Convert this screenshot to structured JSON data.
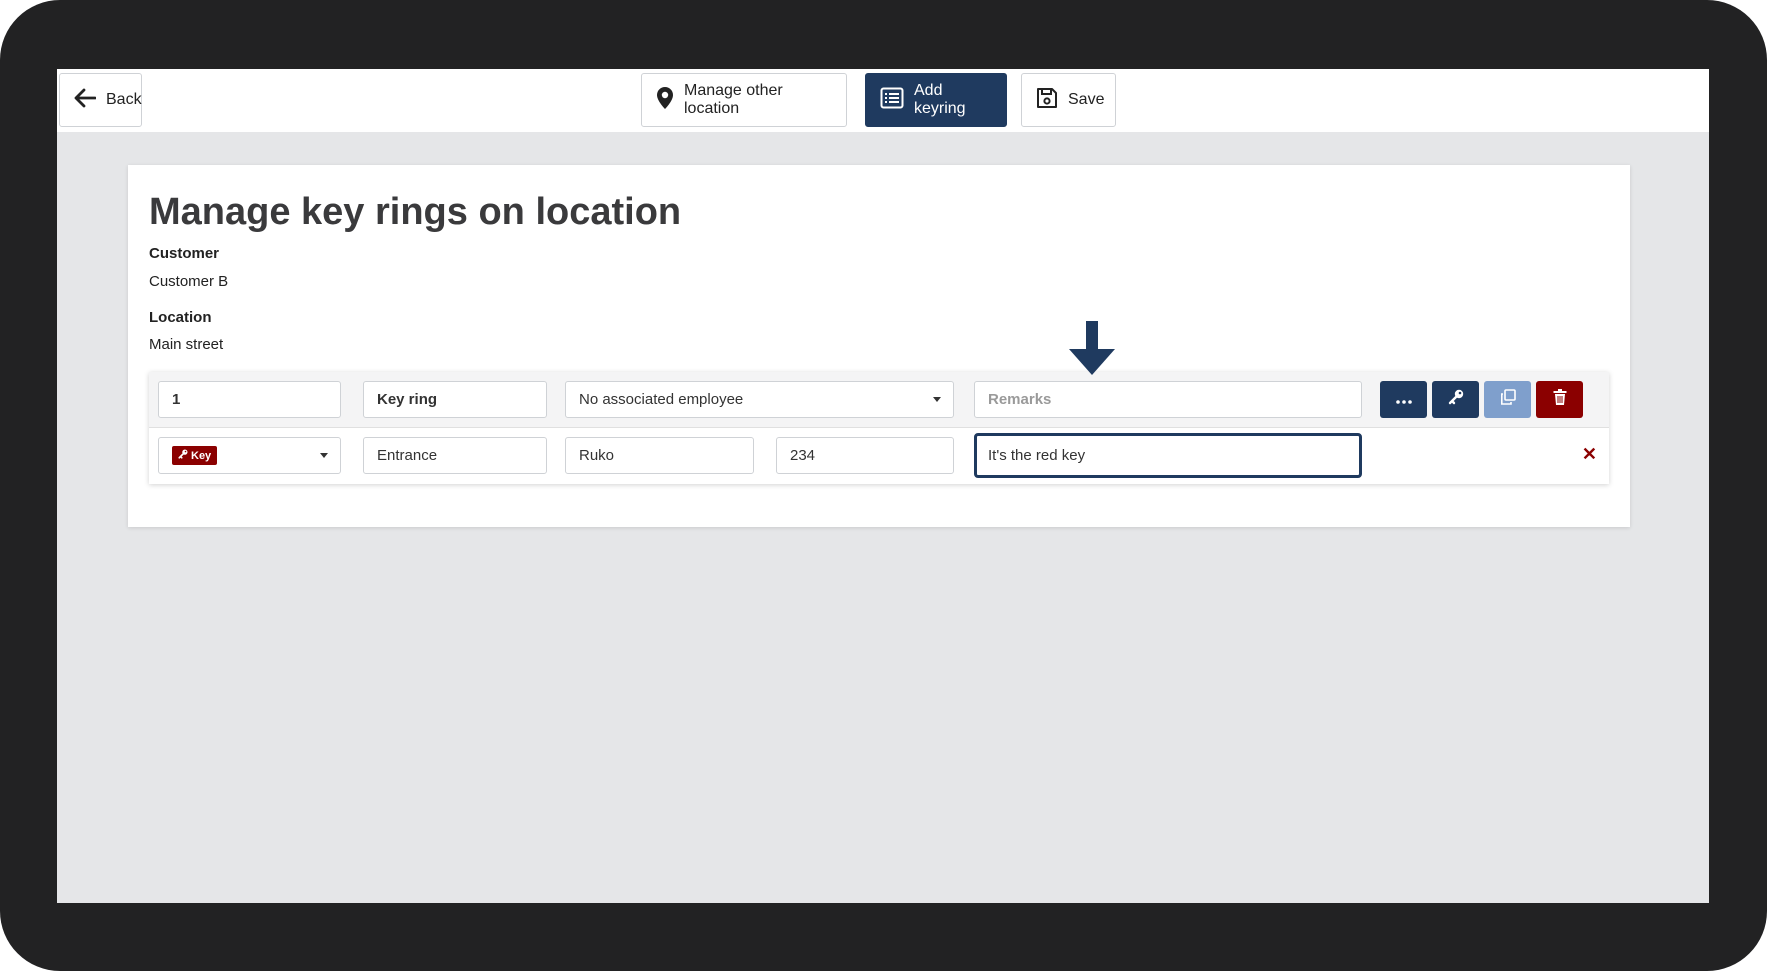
{
  "toolbar": {
    "back_label": "Back",
    "manage_other_location_label": "Manage other location",
    "add_keyring_label": "Add keyring",
    "save_label": "Save"
  },
  "page": {
    "title": "Manage key rings on location",
    "customer_label": "Customer",
    "customer_value": "Customer B",
    "location_label": "Location",
    "location_value": "Main street"
  },
  "keyring_row": {
    "number": "1",
    "name": "Key ring",
    "employee_select": "No associated employee",
    "remarks_placeholder": "Remarks"
  },
  "key_row": {
    "type_badge": "Key",
    "name": "Entrance",
    "field2": "Ruko",
    "field3": "234",
    "remarks": "It's the red key"
  },
  "colors": {
    "primary": "#1f3a5f",
    "danger": "#8b0000",
    "secondary": "#7f9fcc"
  }
}
